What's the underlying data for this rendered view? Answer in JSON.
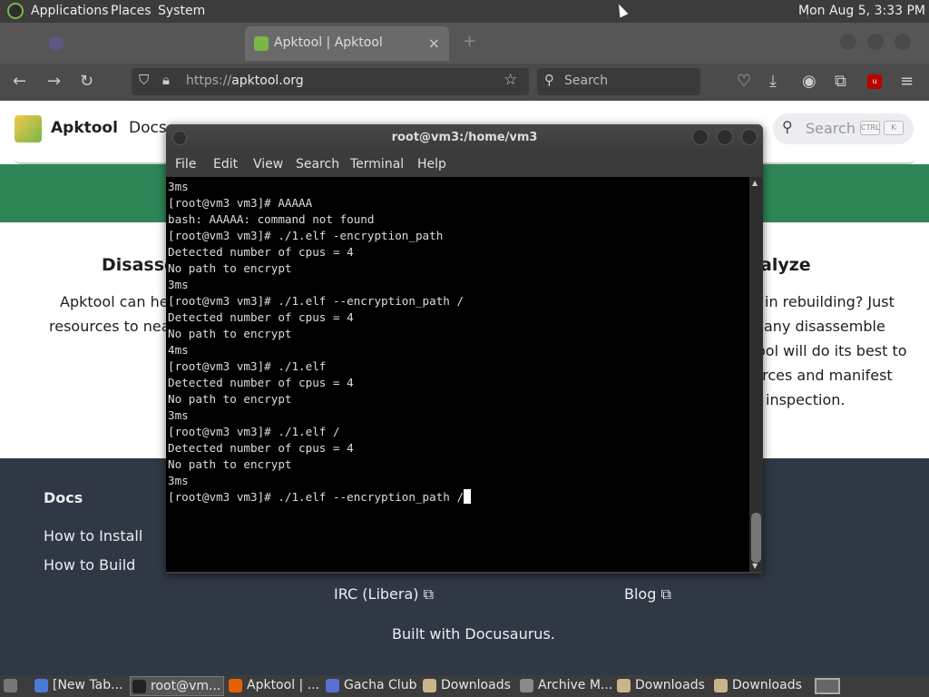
{
  "top_panel": {
    "applications": "Applications",
    "places": "Places",
    "system": "System",
    "clock": "Mon Aug  5,  3:33 PM"
  },
  "browser": {
    "tabs": [
      {
        "label": "",
        "active": false
      },
      {
        "label": "Apktool | Apktool",
        "active": true
      }
    ],
    "url_protocol": "https://",
    "url_host": "apktool.org",
    "search_placeholder": "Search"
  },
  "site": {
    "title": "Apktool",
    "nav_docs": "Docs",
    "search_label": "Search",
    "kbd_ctrl": "CTRL",
    "kbd_k": "K",
    "feature_left_title": "Disasse",
    "feature_left_line1": "Apktool can help",
    "feature_left_line2": "resources to nearl",
    "feature_right_title": "alyze",
    "feature_right_lines": [
      "in rebuilding? Just",
      "any disassemble",
      "ool will do its best to",
      "urces and manifest",
      "inspection."
    ],
    "footer": {
      "docs_title": "Docs",
      "how_install": "How to Install",
      "how_build": "How to Build",
      "irc": "IRC (Libera)",
      "blog": "Blog",
      "built_with": "Built with Docusaurus."
    }
  },
  "terminal": {
    "title": "root@vm3:/home/vm3",
    "menu": [
      "File",
      "Edit",
      "View",
      "Search",
      "Terminal",
      "Help"
    ],
    "lines": [
      "3ms",
      "[root@vm3 vm3]# AAAAA",
      "bash: AAAAA: command not found",
      "[root@vm3 vm3]# ./1.elf -encryption_path",
      "Detected number of cpus = 4",
      "No path to encrypt",
      "3ms",
      "[root@vm3 vm3]# ./1.elf --encryption_path /",
      "Detected number of cpus = 4",
      "No path to encrypt",
      "4ms",
      "[root@vm3 vm3]# ./1.elf",
      "Detected number of cpus = 4",
      "No path to encrypt",
      "3ms",
      "[root@vm3 vm3]# ./1.elf /",
      "Detected number of cpus = 4",
      "No path to encrypt",
      "3ms"
    ],
    "prompt_line": "[root@vm3 vm3]# ./1.elf --encryption_path /"
  },
  "taskbar": {
    "items": [
      {
        "label": "[New Tab...",
        "icon": "chromium-icon",
        "color": "#4a7ad6"
      },
      {
        "label": "root@vm...",
        "icon": "terminal-icon",
        "color": "#222222",
        "active": true
      },
      {
        "label": "Apktool | ...",
        "icon": "firefox-icon",
        "color": "#e66000"
      },
      {
        "label": "Gacha Club",
        "icon": "app-icon",
        "color": "#5a6fd0"
      },
      {
        "label": "Downloads",
        "icon": "folder-icon",
        "color": "#c9b58a"
      },
      {
        "label": "Archive M...",
        "icon": "archive-icon",
        "color": "#8a8a8a"
      },
      {
        "label": "Downloads",
        "icon": "folder-icon",
        "color": "#c9b58a"
      },
      {
        "label": "Downloads",
        "icon": "folder-icon",
        "color": "#c9b58a"
      }
    ]
  }
}
